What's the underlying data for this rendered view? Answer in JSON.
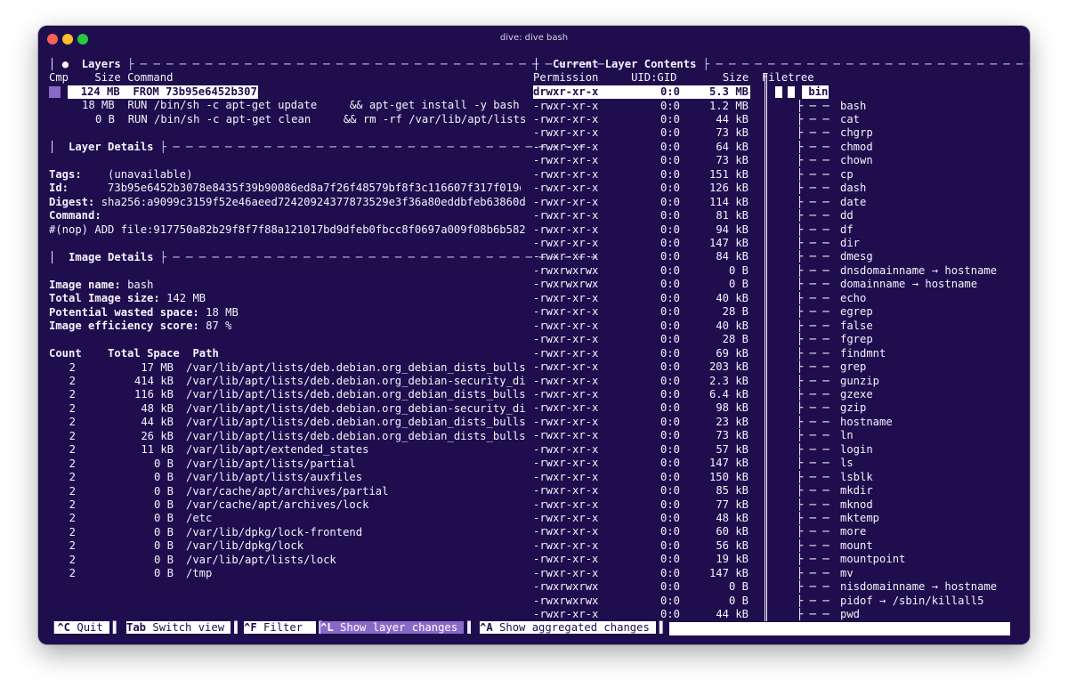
{
  "window": {
    "title": "dive: dive bash"
  },
  "layers": {
    "header_title": "Layers",
    "columns": {
      "cmp": "Cmp",
      "size": "Size",
      "command": "Command"
    },
    "rows": [
      {
        "size": "124 MB",
        "command": "FROM 73b95e6452b3078"
      },
      {
        "size": "18 MB",
        "command": "RUN /bin/sh -c apt-get update     && apt-get install -y bash"
      },
      {
        "size": "0 B",
        "command": "RUN /bin/sh -c apt-get clean     && rm -rf /var/lib/apt/lists"
      }
    ]
  },
  "layer_details": {
    "header_title": "Layer Details",
    "tags_label": "Tags:",
    "tags_value": "(unavailable)",
    "id_label": "Id:",
    "id_value": "73b95e6452b3078e8435f39b90086ed8a7f26f48579bf8f3c116607f317f019d",
    "digest_label": "Digest:",
    "digest_value": "sha256:a9099c3159f52e46aeed72420924377873529e3f36a80eddbfeb63860d",
    "command_label": "Command:",
    "command_value": "#(nop) ADD file:917750a82b29f8f7f88a121017bd9dfeb0fbcc8f0697a009f08b6b582"
  },
  "image_details": {
    "header_title": "Image Details",
    "name_label": "Image name:",
    "name_value": "bash",
    "total_label": "Total Image size:",
    "total_value": "142 MB",
    "wasted_label": "Potential wasted space:",
    "wasted_value": "18 MB",
    "efficiency_label": "Image efficiency score:",
    "efficiency_value": "87 %",
    "columns": {
      "count": "Count",
      "space": "Total Space",
      "path": "Path"
    },
    "rows": [
      {
        "count": "2",
        "space": "17 MB",
        "path": "/var/lib/apt/lists/deb.debian.org_debian_dists_bulls"
      },
      {
        "count": "2",
        "space": "414 kB",
        "path": "/var/lib/apt/lists/deb.debian.org_debian-security_di"
      },
      {
        "count": "2",
        "space": "116 kB",
        "path": "/var/lib/apt/lists/deb.debian.org_debian_dists_bulls"
      },
      {
        "count": "2",
        "space": "48 kB",
        "path": "/var/lib/apt/lists/deb.debian.org_debian-security_di"
      },
      {
        "count": "2",
        "space": "44 kB",
        "path": "/var/lib/apt/lists/deb.debian.org_debian_dists_bulls"
      },
      {
        "count": "2",
        "space": "26 kB",
        "path": "/var/lib/apt/lists/deb.debian.org_debian_dists_bulls"
      },
      {
        "count": "2",
        "space": "11 kB",
        "path": "/var/lib/apt/extended_states"
      },
      {
        "count": "2",
        "space": "0 B",
        "path": "/var/lib/apt/lists/partial"
      },
      {
        "count": "2",
        "space": "0 B",
        "path": "/var/lib/apt/lists/auxfiles"
      },
      {
        "count": "2",
        "space": "0 B",
        "path": "/var/cache/apt/archives/partial"
      },
      {
        "count": "2",
        "space": "0 B",
        "path": "/var/cache/apt/archives/lock"
      },
      {
        "count": "2",
        "space": "0 B",
        "path": "/etc"
      },
      {
        "count": "2",
        "space": "0 B",
        "path": "/var/lib/dpkg/lock-frontend"
      },
      {
        "count": "2",
        "space": "0 B",
        "path": "/var/lib/dpkg/lock"
      },
      {
        "count": "2",
        "space": "0 B",
        "path": "/var/lib/apt/lists/lock"
      },
      {
        "count": "2",
        "space": "0 B",
        "path": "/tmp"
      }
    ]
  },
  "layer_contents": {
    "header_title": "Current Layer Contents",
    "columns": {
      "perm": "Permission",
      "uid": "UID:GID",
      "size": "Size",
      "tree": "Filetree"
    },
    "selected": {
      "perm": "drwxr-xr-x",
      "uid": "0:0",
      "size": "5.3 MB",
      "name": "bin"
    },
    "files": [
      {
        "perm": "-rwxr-xr-x",
        "uid": "0:0",
        "size": "1.2 MB",
        "name": "bash"
      },
      {
        "perm": "-rwxr-xr-x",
        "uid": "0:0",
        "size": "44 kB",
        "name": "cat"
      },
      {
        "perm": "-rwxr-xr-x",
        "uid": "0:0",
        "size": "73 kB",
        "name": "chgrp"
      },
      {
        "perm": "-rwxr-xr-x",
        "uid": "0:0",
        "size": "64 kB",
        "name": "chmod"
      },
      {
        "perm": "-rwxr-xr-x",
        "uid": "0:0",
        "size": "73 kB",
        "name": "chown"
      },
      {
        "perm": "-rwxr-xr-x",
        "uid": "0:0",
        "size": "151 kB",
        "name": "cp"
      },
      {
        "perm": "-rwxr-xr-x",
        "uid": "0:0",
        "size": "126 kB",
        "name": "dash"
      },
      {
        "perm": "-rwxr-xr-x",
        "uid": "0:0",
        "size": "114 kB",
        "name": "date"
      },
      {
        "perm": "-rwxr-xr-x",
        "uid": "0:0",
        "size": "81 kB",
        "name": "dd"
      },
      {
        "perm": "-rwxr-xr-x",
        "uid": "0:0",
        "size": "94 kB",
        "name": "df"
      },
      {
        "perm": "-rwxr-xr-x",
        "uid": "0:0",
        "size": "147 kB",
        "name": "dir"
      },
      {
        "perm": "-rwxr-xr-x",
        "uid": "0:0",
        "size": "84 kB",
        "name": "dmesg"
      },
      {
        "perm": "-rwxrwxrwx",
        "uid": "0:0",
        "size": "0 B",
        "name": "dnsdomainname → hostname"
      },
      {
        "perm": "-rwxrwxrwx",
        "uid": "0:0",
        "size": "0 B",
        "name": "domainname → hostname"
      },
      {
        "perm": "-rwxr-xr-x",
        "uid": "0:0",
        "size": "40 kB",
        "name": "echo"
      },
      {
        "perm": "-rwxr-xr-x",
        "uid": "0:0",
        "size": "28 B",
        "name": "egrep"
      },
      {
        "perm": "-rwxr-xr-x",
        "uid": "0:0",
        "size": "40 kB",
        "name": "false"
      },
      {
        "perm": "-rwxr-xr-x",
        "uid": "0:0",
        "size": "28 B",
        "name": "fgrep"
      },
      {
        "perm": "-rwxr-xr-x",
        "uid": "0:0",
        "size": "69 kB",
        "name": "findmnt"
      },
      {
        "perm": "-rwxr-xr-x",
        "uid": "0:0",
        "size": "203 kB",
        "name": "grep"
      },
      {
        "perm": "-rwxr-xr-x",
        "uid": "0:0",
        "size": "2.3 kB",
        "name": "gunzip"
      },
      {
        "perm": "-rwxr-xr-x",
        "uid": "0:0",
        "size": "6.4 kB",
        "name": "gzexe"
      },
      {
        "perm": "-rwxr-xr-x",
        "uid": "0:0",
        "size": "98 kB",
        "name": "gzip"
      },
      {
        "perm": "-rwxr-xr-x",
        "uid": "0:0",
        "size": "23 kB",
        "name": "hostname"
      },
      {
        "perm": "-rwxr-xr-x",
        "uid": "0:0",
        "size": "73 kB",
        "name": "ln"
      },
      {
        "perm": "-rwxr-xr-x",
        "uid": "0:0",
        "size": "57 kB",
        "name": "login"
      },
      {
        "perm": "-rwxr-xr-x",
        "uid": "0:0",
        "size": "147 kB",
        "name": "ls"
      },
      {
        "perm": "-rwxr-xr-x",
        "uid": "0:0",
        "size": "150 kB",
        "name": "lsblk"
      },
      {
        "perm": "-rwxr-xr-x",
        "uid": "0:0",
        "size": "85 kB",
        "name": "mkdir"
      },
      {
        "perm": "-rwxr-xr-x",
        "uid": "0:0",
        "size": "77 kB",
        "name": "mknod"
      },
      {
        "perm": "-rwxr-xr-x",
        "uid": "0:0",
        "size": "48 kB",
        "name": "mktemp"
      },
      {
        "perm": "-rwxr-xr-x",
        "uid": "0:0",
        "size": "60 kB",
        "name": "more"
      },
      {
        "perm": "-rwxr-xr-x",
        "uid": "0:0",
        "size": "56 kB",
        "name": "mount"
      },
      {
        "perm": "-rwxr-xr-x",
        "uid": "0:0",
        "size": "19 kB",
        "name": "mountpoint"
      },
      {
        "perm": "-rwxr-xr-x",
        "uid": "0:0",
        "size": "147 kB",
        "name": "mv"
      },
      {
        "perm": "-rwxrwxrwx",
        "uid": "0:0",
        "size": "0 B",
        "name": "nisdomainname → hostname"
      },
      {
        "perm": "-rwxrwxrwx",
        "uid": "0:0",
        "size": "0 B",
        "name": "pidof → /sbin/killall5"
      },
      {
        "perm": "-rwxr-xr-x",
        "uid": "0:0",
        "size": "44 kB",
        "name": "pwd"
      }
    ]
  },
  "statusbar": {
    "quit_key": "^C",
    "quit_label": "Quit",
    "switch_key": "Tab",
    "switch_label": "Switch view",
    "filter_key": "^F",
    "filter_label": "Filter",
    "layer_key": "^L",
    "layer_label": "Show layer changes",
    "agg_key": "^A",
    "agg_label": "Show aggregated changes"
  },
  "colors": {
    "background": "#1e0e4e",
    "accent": "#8a68c8",
    "foreground": "#f4f2fa"
  }
}
